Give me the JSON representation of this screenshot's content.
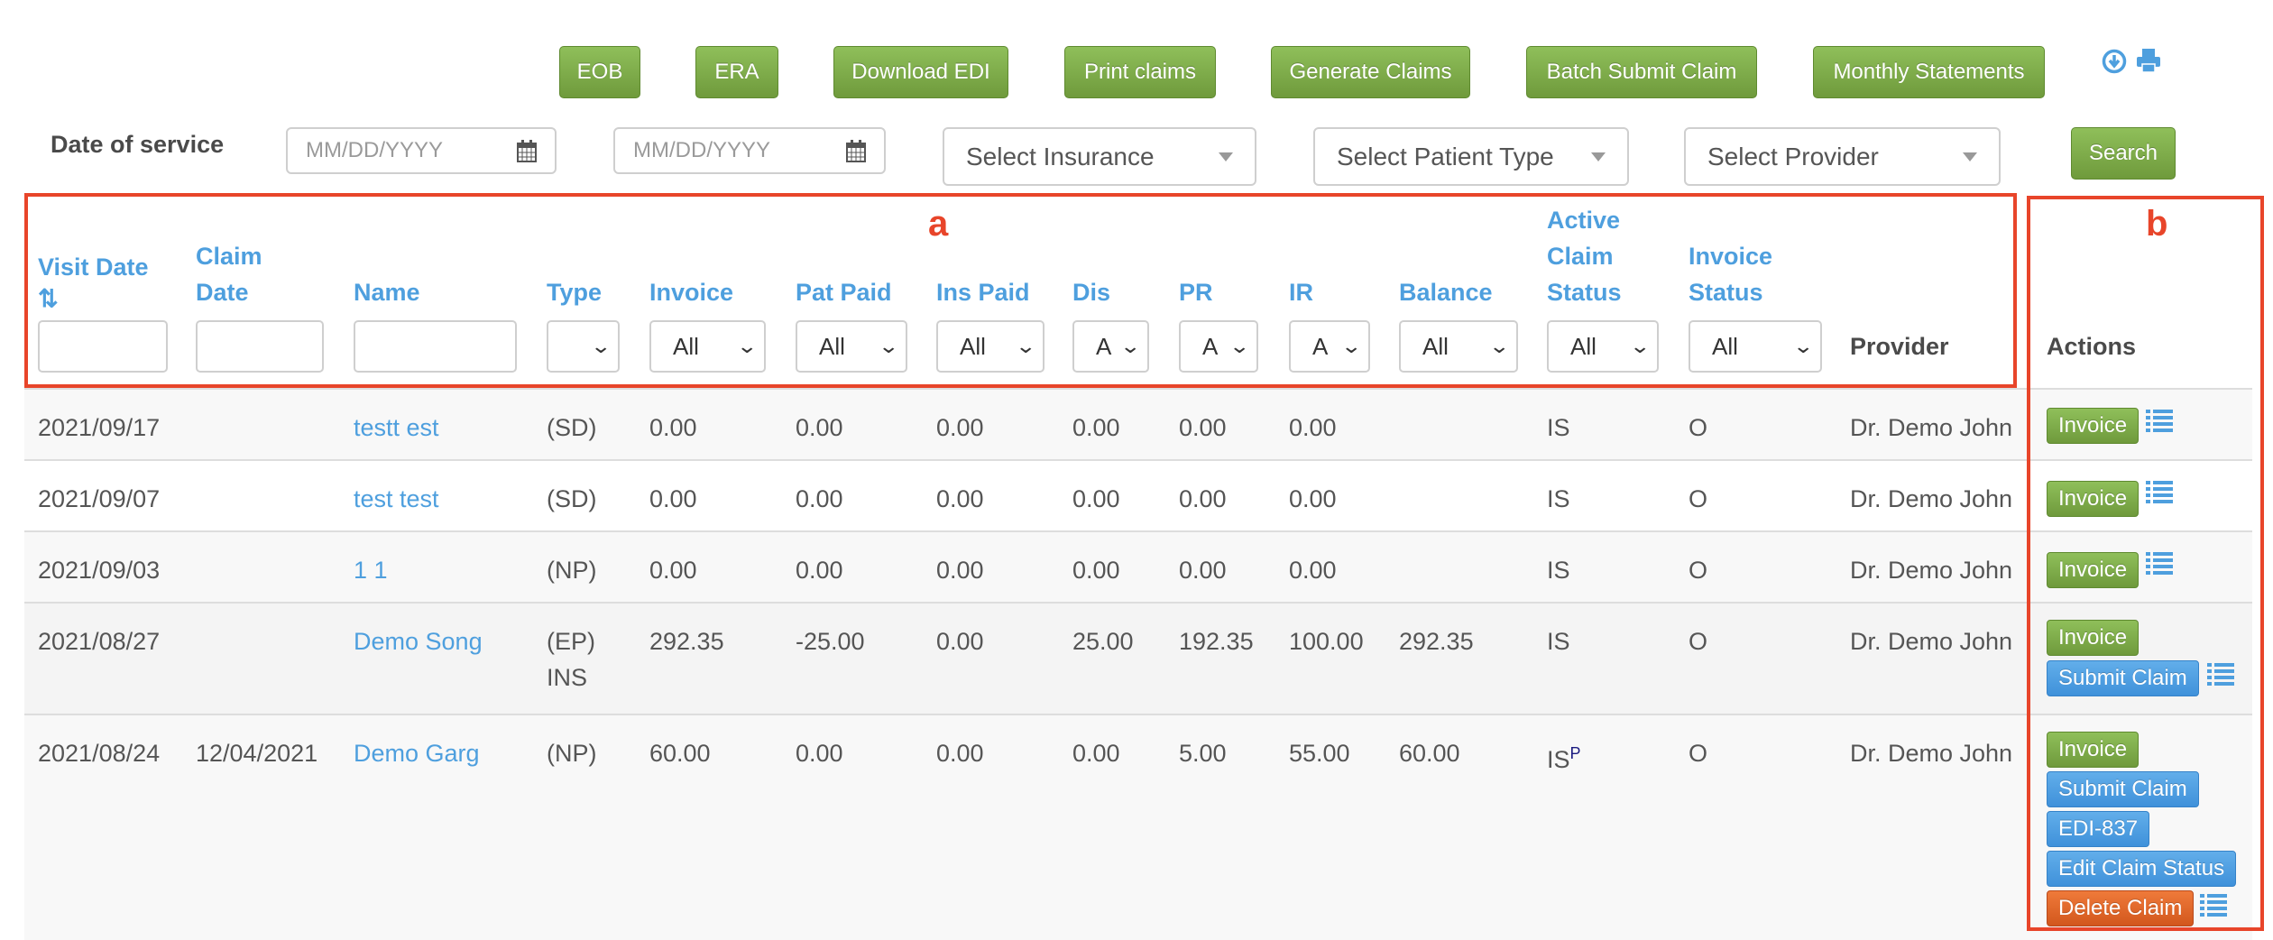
{
  "toolbar": {
    "buttons": [
      {
        "label": "EOB"
      },
      {
        "label": "ERA"
      },
      {
        "label": "Download EDI"
      },
      {
        "label": "Print claims"
      },
      {
        "label": "Generate Claims"
      },
      {
        "label": "Batch Submit Claim"
      },
      {
        "label": "Monthly Statements"
      }
    ],
    "icons": [
      "download-circle-icon",
      "print-icon"
    ]
  },
  "filters": {
    "date_label": "Date of service",
    "date_from_placeholder": "MM/DD/YYYY",
    "date_to_placeholder": "MM/DD/YYYY",
    "insurance_select": "Select Insurance",
    "patient_type_select": "Select Patient Type",
    "provider_select": "Select Provider",
    "search_label": "Search"
  },
  "annotations": {
    "box_a": "a",
    "box_b": "b"
  },
  "colors": {
    "accent_blue": "#4e9fde",
    "green": "#7aa847",
    "orange": "#e0662a",
    "annotation_red": "#e8452a"
  },
  "table": {
    "headers": {
      "visit_date": "Visit Date",
      "sort_icon": "⇅",
      "claim_date_1": "Claim",
      "claim_date_2": "Date",
      "name": "Name",
      "type": "Type",
      "invoice": "Invoice",
      "pat_paid": "Pat Paid",
      "ins_paid": "Ins Paid",
      "dis": "Dis",
      "pr": "PR",
      "ir": "IR",
      "balance": "Balance",
      "active_1": "Active",
      "active_2": "Claim",
      "active_3": "Status",
      "invstatus_1": "Invoice",
      "invstatus_2": "Status",
      "provider": "Provider",
      "actions": "Actions"
    },
    "filter_values": {
      "type": "",
      "invoice": "All",
      "pat_paid": "All",
      "ins_paid": "All",
      "dis": "A",
      "pr": "A",
      "ir": "A",
      "balance": "All",
      "active": "All",
      "invstatus": "All"
    },
    "rows": [
      {
        "visit_date": "2021/09/17",
        "claim_date": "",
        "name": "testt est",
        "type": "(SD)",
        "type2": "",
        "invoice": "0.00",
        "pat_paid": "0.00",
        "ins_paid": "0.00",
        "dis": "0.00",
        "pr": "0.00",
        "ir": "0.00",
        "balance": "",
        "active": "IS",
        "active_sup": "",
        "invstatus": "O",
        "provider": "Dr. Demo John",
        "actions": [
          "Invoice"
        ]
      },
      {
        "visit_date": "2021/09/07",
        "claim_date": "",
        "name": "test test",
        "type": "(SD)",
        "type2": "",
        "invoice": "0.00",
        "pat_paid": "0.00",
        "ins_paid": "0.00",
        "dis": "0.00",
        "pr": "0.00",
        "ir": "0.00",
        "balance": "",
        "active": "IS",
        "active_sup": "",
        "invstatus": "O",
        "provider": "Dr. Demo John",
        "actions": [
          "Invoice"
        ]
      },
      {
        "visit_date": "2021/09/03",
        "claim_date": "",
        "name": "1 1",
        "type": "(NP)",
        "type2": "",
        "invoice": "0.00",
        "pat_paid": "0.00",
        "ins_paid": "0.00",
        "dis": "0.00",
        "pr": "0.00",
        "ir": "0.00",
        "balance": "",
        "active": "IS",
        "active_sup": "",
        "invstatus": "O",
        "provider": "Dr. Demo John",
        "actions": [
          "Invoice"
        ]
      },
      {
        "visit_date": "2021/08/27",
        "claim_date": "",
        "name": "Demo Song",
        "type": "(EP)",
        "type2": "INS",
        "invoice": "292.35",
        "pat_paid": "-25.00",
        "ins_paid": "0.00",
        "dis": "25.00",
        "pr": "192.35",
        "ir": "100.00",
        "balance": "292.35",
        "active": "IS",
        "active_sup": "",
        "invstatus": "O",
        "provider": "Dr. Demo John",
        "actions": [
          "Invoice",
          "Submit Claim"
        ]
      },
      {
        "visit_date": "2021/08/24",
        "claim_date": "12/04/2021",
        "name": "Demo Garg",
        "type": "(NP)",
        "type2": "",
        "invoice": "60.00",
        "pat_paid": "0.00",
        "ins_paid": "0.00",
        "dis": "0.00",
        "pr": "5.00",
        "ir": "55.00",
        "balance": "60.00",
        "active": "IS",
        "active_sup": "P",
        "invstatus": "O",
        "provider": "Dr. Demo John",
        "actions": [
          "Invoice",
          "Submit Claim",
          "EDI-837",
          "Edit Claim Status",
          "Delete Claim"
        ]
      }
    ]
  }
}
